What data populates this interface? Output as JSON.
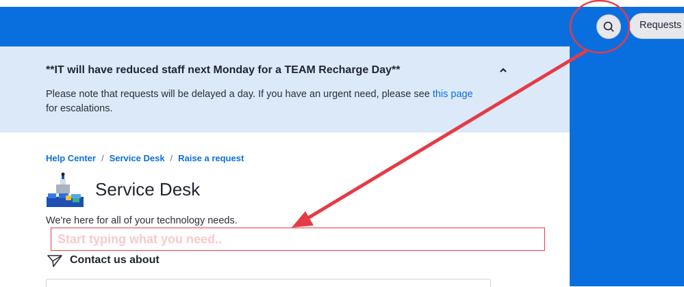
{
  "header": {
    "requests_label": "Requests",
    "search_icon": "search-icon"
  },
  "banner": {
    "title": "**IT will have reduced staff next Monday for a TEAM Recharge Day**",
    "body_before_link": "Please note that requests will be delayed a day. If you have an urgent need, please see ",
    "link_text": "this page",
    "body_after_link": "for escalations.",
    "collapse_icon": "chevron-up-icon"
  },
  "breadcrumb": {
    "items": [
      "Help Center",
      "Service Desk",
      "Raise a request"
    ],
    "separator": "/"
  },
  "service_desk": {
    "title": "Service Desk",
    "subtitle": "We're here for all of your technology needs."
  },
  "search": {
    "placeholder": "Start typing what you need.."
  },
  "contact": {
    "label": "Contact us about",
    "icon": "paper-plane-icon"
  },
  "colors": {
    "brand_blue": "#0a6fde",
    "banner_bg": "#dbe9f8",
    "annotation_red": "#e53b46"
  }
}
